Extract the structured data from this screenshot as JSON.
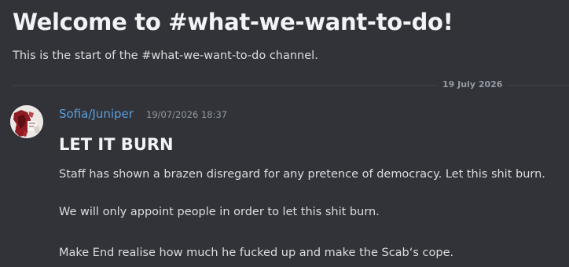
{
  "channel": {
    "welcome_title": "Welcome to #what-we-want-to-do!",
    "welcome_subtitle": "This is the start of the #what-we-want-to-do channel."
  },
  "divider": {
    "date": "19 July 2026"
  },
  "message": {
    "author": "Sofia/Juniper",
    "timestamp": "19/07/2026 18:37",
    "heading": "LET IT BURN",
    "lines": [
      "Staff has shown a brazen disregard for any pretence of democracy. Let this shit burn.",
      "We will only appoint people in order to let this shit burn.",
      "Make End realise how much he fucked up and make the Scab‘s cope."
    ]
  },
  "colors": {
    "background": "#313338",
    "username": "#5a9fe0",
    "text": "#dbdee1",
    "muted": "#949ba4"
  }
}
